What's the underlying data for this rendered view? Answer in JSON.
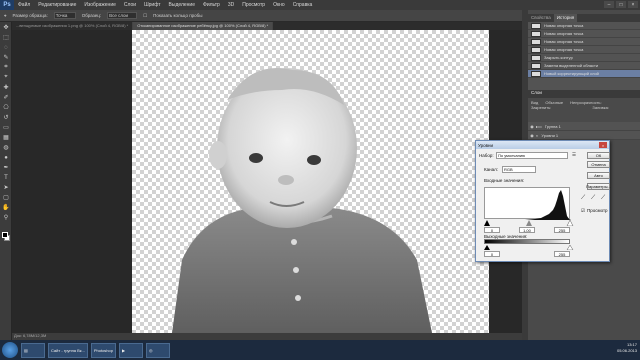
{
  "app": {
    "logo": "Ps"
  },
  "menu": [
    "Файл",
    "Редактирование",
    "Изображение",
    "Слои",
    "Шрифт",
    "Выделение",
    "Фильтр",
    "3D",
    "Просмотр",
    "Окно",
    "Справка"
  ],
  "window_buttons": [
    "–",
    "□",
    "×"
  ],
  "options": {
    "sample_label": "Размер образца:",
    "sample_value": "Точка",
    "sample_all_label": "Образец:",
    "sample_all_value": "Все слои",
    "show_ring": "Показать кольцо пробы"
  },
  "tabs": [
    {
      "label": "...венщуемые изображения 1.png @ 100% (Слой 4, RGB/8) *",
      "active": false
    },
    {
      "label": "Отсканированное изображение ребёнку.jpg @ 100% (Слой 4, RGB/8) *",
      "active": true
    }
  ],
  "statusbar": "Док: 6,78M/12,3M",
  "panels": {
    "history_tabs": [
      {
        "label": "Свойства",
        "active": false
      },
      {
        "label": "История",
        "active": true
      }
    ],
    "history_items": [
      {
        "label": "Новая опорная точка",
        "selected": false
      },
      {
        "label": "Новая опорная точка",
        "selected": false
      },
      {
        "label": "Новая опорная точка",
        "selected": false
      },
      {
        "label": "Новая опорная точка",
        "selected": false
      },
      {
        "label": "Закрыть контур",
        "selected": false
      },
      {
        "label": "Замена выделенной области",
        "selected": false
      },
      {
        "label": "Новый корректирующий слой",
        "selected": true
      }
    ],
    "layers_title": "Слои",
    "layers_opts": [
      "Вид",
      "Обычные",
      "Непрозрачность:",
      "Закрепить:",
      "Заливка:"
    ],
    "layers": [
      {
        "label": "Группа 1"
      },
      {
        "label": "Уровни 1"
      }
    ]
  },
  "dialog": {
    "title": "Уровни",
    "close": "×",
    "preset_label": "Набор:",
    "preset_value": "По умолчанию",
    "channel_label": "Канал:",
    "channel_value": "RGB",
    "input_label": "Входные значения:",
    "input_black": "0",
    "input_gamma": "1,00",
    "input_white": "255",
    "output_label": "Выходные значения:",
    "output_black": "0",
    "output_white": "255",
    "buttons": {
      "ok": "ОК",
      "cancel": "Отмена",
      "auto": "Авто",
      "params": "Параметры..."
    },
    "preview_label": "Просмотр",
    "preview_checked": true
  },
  "taskbar": {
    "items": [
      "Сайт - группа Вк...",
      "Photoshop"
    ],
    "time": "13:17",
    "date": "05.06.2013"
  },
  "colors": {
    "accent": "#6b7fa3",
    "canvas_bg": "#282828"
  }
}
